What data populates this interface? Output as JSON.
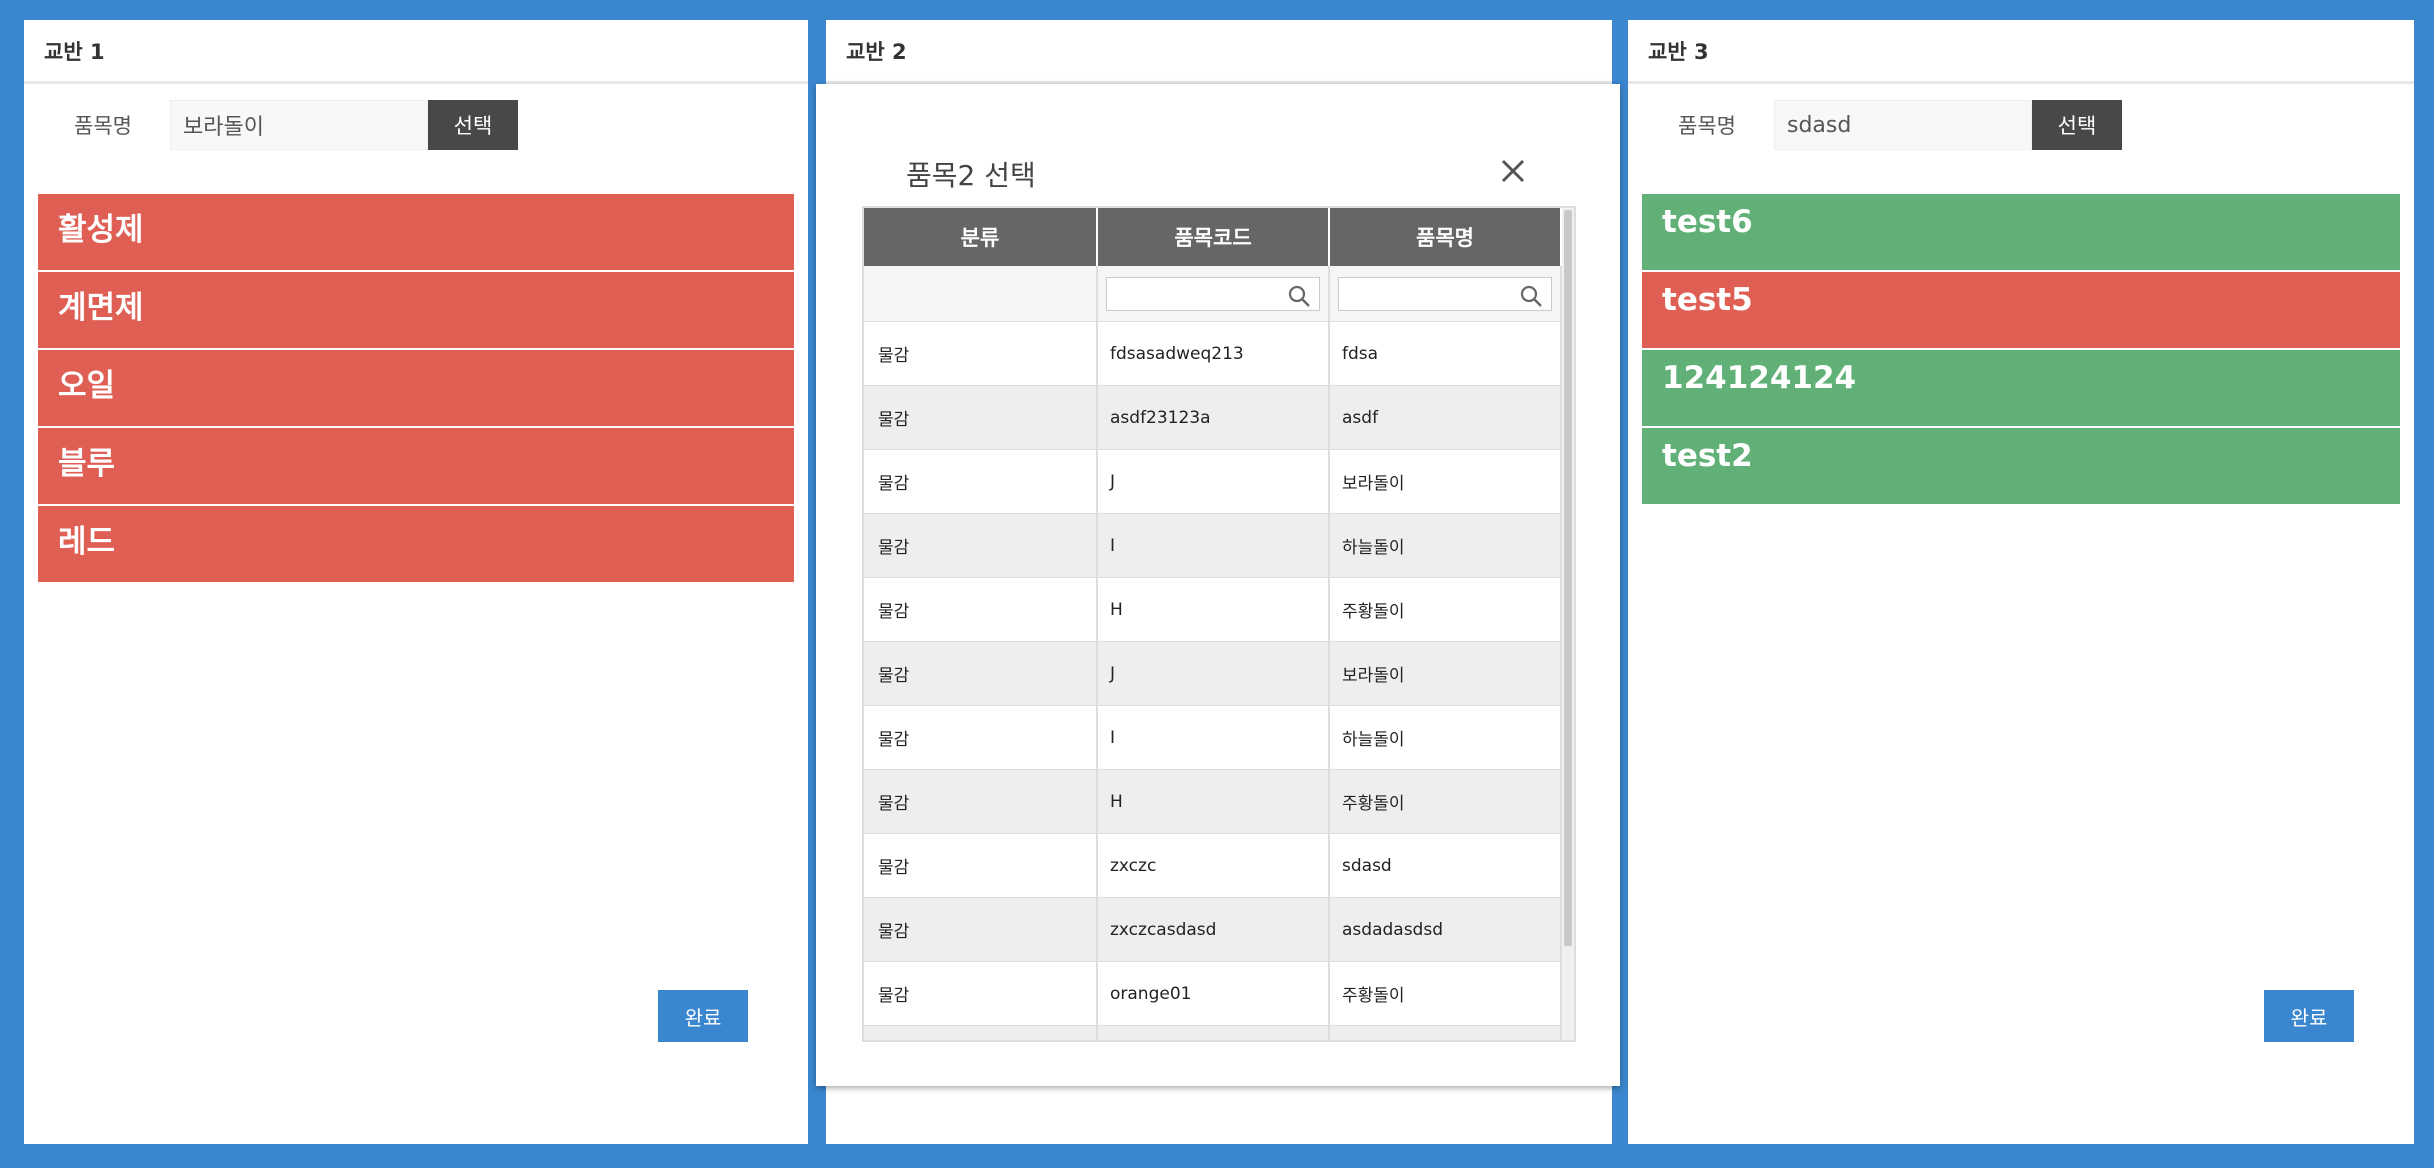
{
  "panels": [
    {
      "title": "교반 1",
      "search_label": "품목명",
      "search_value": "보라돌이",
      "select_label": "선택",
      "done_label": "완료",
      "items": [
        {
          "label": "활성제",
          "color": "#df5f55"
        },
        {
          "label": "계면제",
          "color": "#df5f55"
        },
        {
          "label": "오일",
          "color": "#df5f55"
        },
        {
          "label": "블루",
          "color": "#df5f55"
        },
        {
          "label": "레드",
          "color": "#df5f55"
        }
      ]
    },
    {
      "title": "교반 2"
    },
    {
      "title": "교반 3",
      "search_label": "품목명",
      "search_value": "sdasd",
      "select_label": "선택",
      "done_label": "완료",
      "items": [
        {
          "label": "test6",
          "color": "#61b077"
        },
        {
          "label": "test5",
          "color": "#df5f55"
        },
        {
          "label": "124124124",
          "color": "#61b077"
        },
        {
          "label": "test2",
          "color": "#61b077"
        }
      ]
    }
  ],
  "modal": {
    "title": "품목2 선택",
    "close_icon": "close-icon",
    "columns": [
      "분류",
      "품목코드",
      "품목명"
    ],
    "filter_icon": "search-icon",
    "rows": [
      [
        "물감",
        "fdsasadweq213",
        "fdsa"
      ],
      [
        "물감",
        "asdf23123a",
        "asdf"
      ],
      [
        "물감",
        "J",
        "보라돌이"
      ],
      [
        "물감",
        "I",
        "하늘돌이"
      ],
      [
        "물감",
        "H",
        "주황돌이"
      ],
      [
        "물감",
        "J",
        "보라돌이"
      ],
      [
        "물감",
        "I",
        "하늘돌이"
      ],
      [
        "물감",
        "H",
        "주황돌이"
      ],
      [
        "물감",
        "zxczc",
        "sdasd"
      ],
      [
        "물감",
        "zxczcasdasd",
        "asdadasdsd"
      ],
      [
        "물감",
        "orange01",
        "주황돌이"
      ]
    ]
  },
  "colors": {
    "background": "#3a87cf",
    "item_red": "#df5f55",
    "item_green": "#61b077",
    "select_button": "#484848",
    "done_button": "#3a87cf",
    "grid_header": "#666666"
  }
}
